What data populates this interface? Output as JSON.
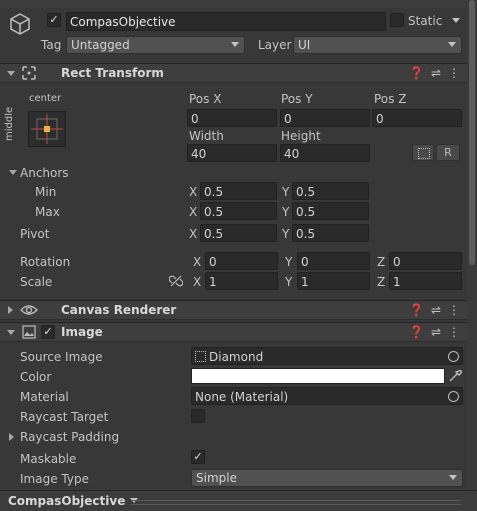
{
  "header": {
    "object_name": "CompasObjective",
    "static_label": "Static",
    "tag_label": "Tag",
    "tag_value": "Untagged",
    "layer_label": "Layer",
    "layer_value": "UI"
  },
  "rect_transform": {
    "title": "Rect Transform",
    "anchor_preset_top": "center",
    "anchor_preset_side": "middle",
    "pos_x_label": "Pos X",
    "pos_y_label": "Pos Y",
    "pos_z_label": "Pos Z",
    "pos_x": "0",
    "pos_y": "0",
    "pos_z": "0",
    "width_label": "Width",
    "height_label": "Height",
    "width": "40",
    "height": "40",
    "raw_edit_label": "R",
    "anchors_label": "Anchors",
    "min_label": "Min",
    "max_label": "Max",
    "anchor_min_x": "0.5",
    "anchor_min_y": "0.5",
    "anchor_max_x": "0.5",
    "anchor_max_y": "0.5",
    "pivot_label": "Pivot",
    "pivot_x": "0.5",
    "pivot_y": "0.5",
    "rotation_label": "Rotation",
    "rot_x": "0",
    "rot_y": "0",
    "rot_z": "0",
    "scale_label": "Scale",
    "scale_x": "1",
    "scale_y": "1",
    "scale_z": "1",
    "x": "X",
    "y": "Y",
    "z": "Z"
  },
  "canvas_renderer": {
    "title": "Canvas Renderer"
  },
  "image": {
    "title": "Image",
    "source_image_label": "Source Image",
    "source_image_value": "Diamond",
    "color_label": "Color",
    "color_value": "#ffffff",
    "material_label": "Material",
    "material_value": "None (Material)",
    "raycast_target_label": "Raycast Target",
    "raycast_padding_label": "Raycast Padding",
    "maskable_label": "Maskable",
    "image_type_label": "Image Type",
    "image_type_value": "Simple"
  },
  "footer": {
    "label": "CompasObjective"
  },
  "colors": {
    "accent": "#c84a3a",
    "panel": "#383838",
    "header": "#3e3e3e"
  }
}
